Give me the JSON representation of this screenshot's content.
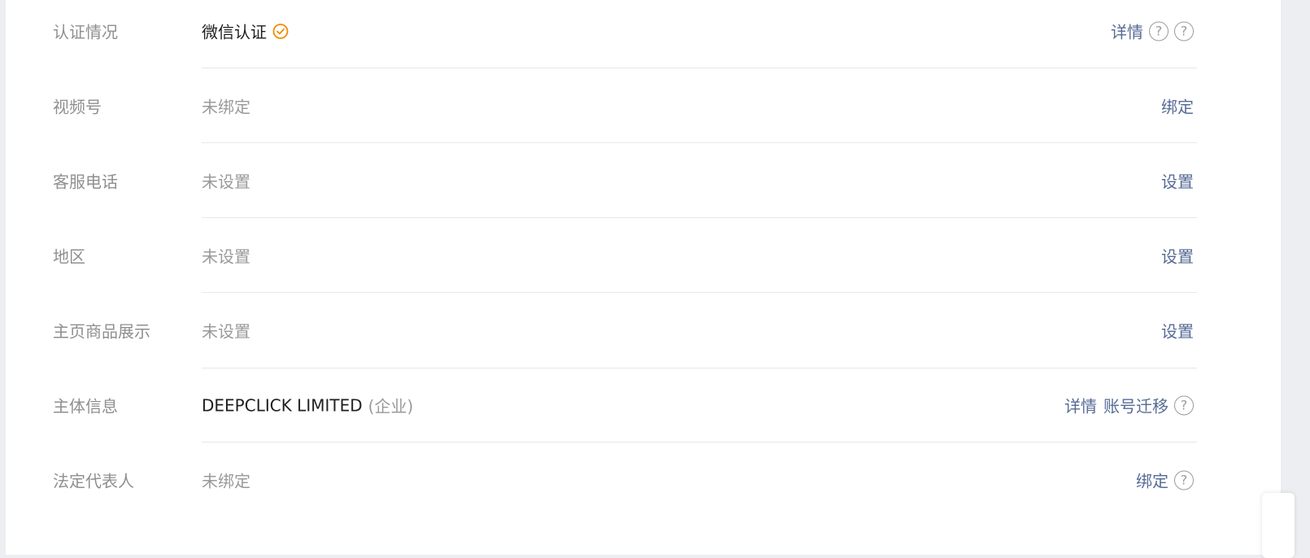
{
  "rows": [
    {
      "label": "认证情况",
      "value": "微信认证",
      "verified": true,
      "actions": [
        "详情"
      ],
      "help_icons": 2
    },
    {
      "label": "视频号",
      "value": "未绑定",
      "actions": [
        "绑定"
      ],
      "help_icons": 0
    },
    {
      "label": "客服电话",
      "value": "未设置",
      "actions": [
        "设置"
      ],
      "help_icons": 0
    },
    {
      "label": "地区",
      "value": "未设置",
      "actions": [
        "设置"
      ],
      "help_icons": 0
    },
    {
      "label": "主页商品展示",
      "value": "未设置",
      "actions": [
        "设置"
      ],
      "help_icons": 0
    },
    {
      "label": "主体信息",
      "value": "DEEPCLICK LIMITED",
      "value_suffix": "(企业)",
      "actions": [
        "详情",
        "账号迁移"
      ],
      "help_icons": 1
    },
    {
      "label": "法定代表人",
      "value": "未绑定",
      "actions": [
        "绑定"
      ],
      "help_icons": 1
    }
  ],
  "colors": {
    "label": "#8f8f8f",
    "value_muted": "#9a9a9a",
    "value_strong": "#1f1f1f",
    "link": "#576b95",
    "verified_orange": "#f28b00",
    "divider": "#e7e7e7"
  },
  "icons": {
    "help": "question-circle-icon",
    "verified": "check-circle-icon"
  },
  "help_glyph": "?"
}
